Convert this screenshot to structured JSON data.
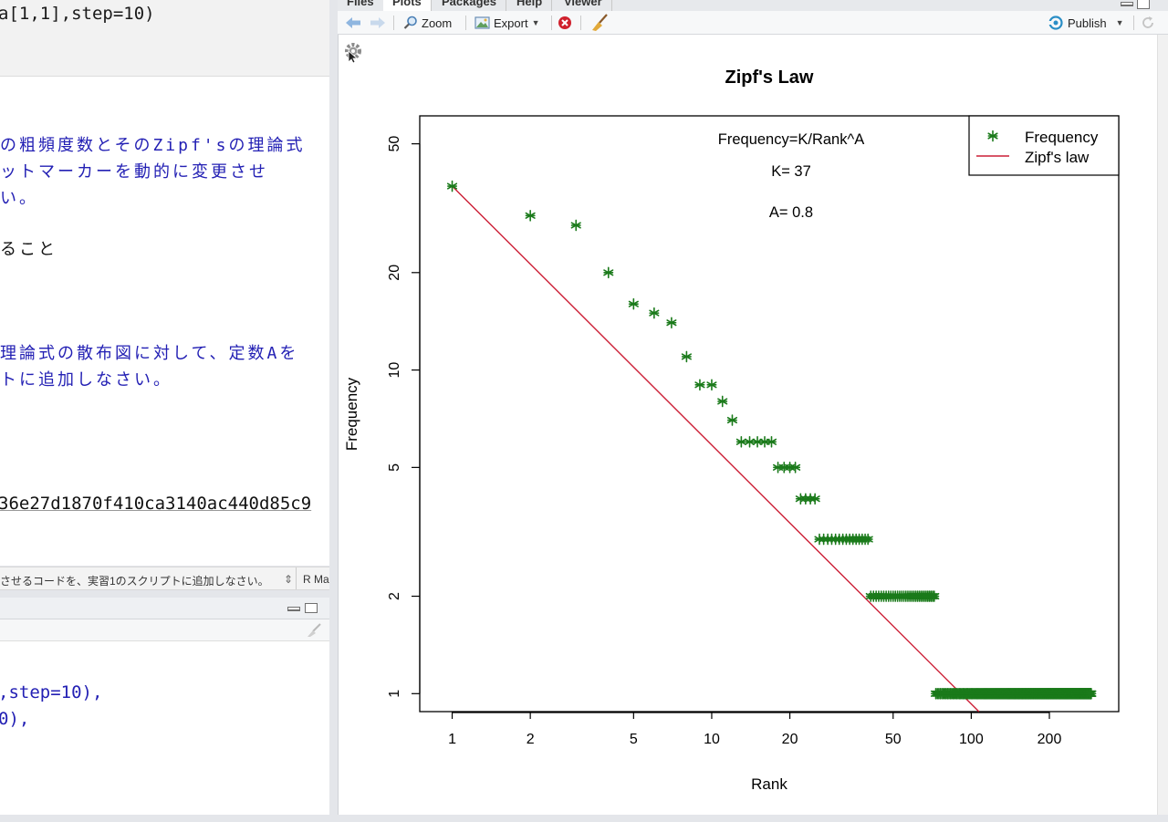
{
  "editor": {
    "code_line": "a[1,1],step=10)",
    "jp_lines": [
      "の粗頻度数とそのZipf'sの理論式",
      "ットマーカーを動的に変更させ",
      "い。"
    ],
    "jp_line_black": "ること",
    "jp_lines_2": [
      "理論式の散布図に対して、定数Aを",
      "トに追加しなさい。"
    ],
    "hash": "36e27d1870f410ca3140ac440d85c9",
    "status_text": "させるコードを、実習1のスクリプトに追加しなさい。",
    "status_arrow": "⇕",
    "status_mode": "R Ma"
  },
  "console": {
    "lines": [
      ",step=10),",
      "0),"
    ]
  },
  "plots_pane": {
    "tabs": [
      "Files",
      "Plots",
      "Packages",
      "Help",
      "Viewer"
    ],
    "toolbar": {
      "zoom": "Zoom",
      "export": "Export",
      "publish": "Publish"
    }
  },
  "chart_data": {
    "type": "scatter",
    "title": "Zipf's Law",
    "xlabel": "Rank",
    "ylabel": "Frequency",
    "x_scale": "log",
    "y_scale": "log",
    "xlim": [
      0.75,
      370
    ],
    "ylim": [
      0.88,
      61
    ],
    "xticks": [
      1,
      2,
      5,
      10,
      20,
      50,
      100,
      200
    ],
    "yticks": [
      1,
      2,
      5,
      10,
      20,
      50
    ],
    "annotations": [
      "Frequency=K/Rank^A",
      "K= 37",
      "A= 0.8"
    ],
    "legend": {
      "position": "top-right",
      "entries": [
        {
          "label": "Frequency",
          "symbol": "asterisk",
          "color": "#1a7a1a"
        },
        {
          "label": "Zipf's law",
          "symbol": "line",
          "color": "#cc1f36"
        }
      ]
    },
    "series": [
      {
        "name": "Frequency",
        "color": "#1a7a1a",
        "points": [
          [
            1,
            37
          ],
          [
            2,
            30
          ],
          [
            3,
            28
          ],
          [
            4,
            20
          ],
          [
            5,
            16
          ],
          [
            6,
            15
          ],
          [
            7,
            14
          ],
          [
            8,
            11
          ],
          [
            9,
            9
          ],
          [
            10,
            9
          ],
          [
            11,
            8
          ],
          [
            12,
            7
          ],
          [
            13,
            6
          ],
          [
            14,
            6
          ],
          [
            15,
            6
          ],
          [
            16,
            6
          ],
          [
            17,
            6
          ],
          [
            18,
            5
          ],
          [
            19,
            5
          ],
          [
            20,
            5
          ],
          [
            21,
            5
          ],
          [
            22,
            4
          ],
          [
            23,
            4
          ],
          [
            24,
            4
          ],
          [
            25,
            4
          ]
        ],
        "runs": [
          {
            "y": 3,
            "from": 26,
            "to": 40
          },
          {
            "y": 2,
            "from": 41,
            "to": 72
          },
          {
            "y": 1,
            "from": 73,
            "to": 290
          }
        ]
      },
      {
        "name": "Zipf's law",
        "color": "#cc1f36",
        "formula": "K/Rank^A",
        "K": 37,
        "A": 0.8
      }
    ]
  }
}
